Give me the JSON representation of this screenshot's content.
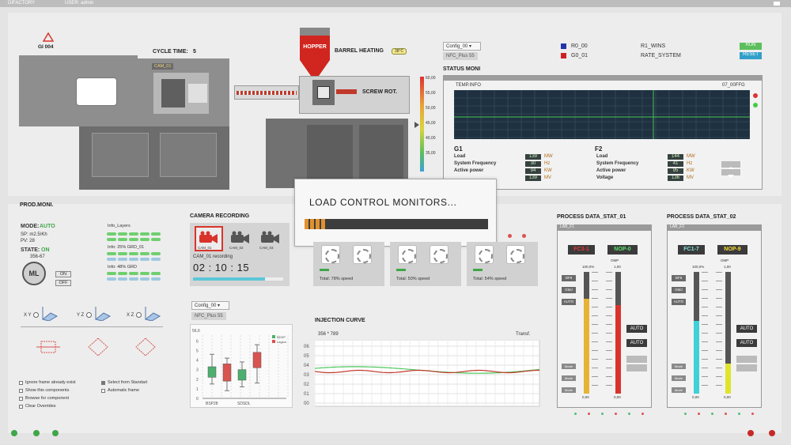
{
  "topbar": {
    "app": "DIFACTORY",
    "user": "USER: admin"
  },
  "machine": {
    "code": "GI 004",
    "cycle_label": "CYCLE TIME:",
    "cycle_value": "5",
    "cam_tag": "CAM_01",
    "hopper": "HOPPER",
    "barrel_heating": "BARREL HEATING",
    "barrel_temp": "38°C",
    "screw": "SCREW ROT."
  },
  "temp_scale": [
    "60,00",
    "55,00",
    "50,00",
    "45,00",
    "40,00",
    "35,00"
  ],
  "config": {
    "select": "Config_00",
    "nfc": "NFC_Plus 55"
  },
  "legend": {
    "r0": "R0_00",
    "g0": "G0_01",
    "r1": "R1_WINS",
    "rate": "RATE_SYSTEM",
    "run": "RUN",
    "reset": "RESET"
  },
  "status": {
    "title": "STATUS MONI",
    "temp_info": "TEMP.INFO",
    "temp_code": "07_00FFG",
    "g1": {
      "title": "G1",
      "rows": [
        {
          "label": "Load",
          "value": "139",
          "unit": "MW"
        },
        {
          "label": "System Frequency",
          "value": "30",
          "unit": "Hz"
        },
        {
          "label": "Active power",
          "value": "94",
          "unit": "KW"
        },
        {
          "label": "",
          "value": "139",
          "unit": "MV"
        }
      ]
    },
    "f2": {
      "title": "F2",
      "rows": [
        {
          "label": "Load",
          "value": "144",
          "unit": "MW"
        },
        {
          "label": "System Frequency",
          "value": "41",
          "unit": "Hz"
        },
        {
          "label": "Active power",
          "value": "95",
          "unit": "KW"
        },
        {
          "label": "Voltage",
          "value": "136",
          "unit": "MV"
        }
      ]
    }
  },
  "modal": {
    "title": "LOAD CONTROL MONITORS...",
    "progress": 0.11
  },
  "prod": {
    "title": "PROD.MONI.",
    "mode_label": "MODE:",
    "mode_value": "AUTO",
    "sp": "SP: m2.5/Kh",
    "pv": "PV: 28",
    "state_label": "STATE:",
    "state_value": "ON",
    "count": "356-67",
    "ml": "ML",
    "on": "ON",
    "off": "OFF",
    "info_layers": "Info_Layers",
    "info1": "Info: 25% GRD_01",
    "info2": "Info: 48% GRD",
    "axes": [
      "X Y",
      "Y Z",
      "X Z"
    ]
  },
  "options": [
    {
      "label": "Ignore frame already exist",
      "checked": false
    },
    {
      "label": "Select from Standart",
      "checked": true
    },
    {
      "label": "Show this components",
      "checked": false
    },
    {
      "label": "Automatic frame",
      "checked": false
    },
    {
      "label": "Browse for component",
      "checked": false
    },
    {
      "label": "Clear Overrides",
      "checked": false
    }
  ],
  "camera": {
    "title": "CAMERA RECORDING",
    "cams": [
      "CAM_01",
      "CAM_02",
      "CAM_03"
    ],
    "recording": "CAM_01 recording",
    "timer": "02 : 10 : 15"
  },
  "fans": [
    {
      "speed": "Total: 78% speed"
    },
    {
      "speed": "Total: 50% speed"
    },
    {
      "speed": "Total: 54% speed"
    }
  ],
  "config2": {
    "select": "Config_00",
    "nfc": "NFC_Plus 55"
  },
  "injection": {
    "title": "INJECTION CURVE",
    "coords": "356 * 789",
    "transf": "Transf."
  },
  "injection_y": [
    "06",
    "05",
    "04",
    "03",
    "02",
    "01",
    "00"
  ],
  "proc1": {
    "title": "PROCESS DATA_STAT_01",
    "win": "LAB_F1",
    "badge_a": "FC3-1",
    "badge_b": "NOP-0",
    "col_a": "100,0%",
    "col_b": "1,00",
    "omp": "OMP",
    "side": [
      "DF6",
      "GMJ",
      "AUTO"
    ],
    "auto1": "AUTO",
    "auto2": "AUTO",
    "mode": [
      "Mode",
      "Mode",
      "Mode"
    ],
    "bottom": [
      "0,00",
      "0,00"
    ],
    "fill_a": 0.78,
    "fill_b": 0.73
  },
  "proc2": {
    "title": "PROCESS DATA_STAT_02",
    "win": "LAB_F2",
    "badge_a": "FC1-7",
    "badge_b": "NOP-9",
    "col_a": "100,0%",
    "col_b": "1,00",
    "omp": "OMP",
    "side": [
      "DF6",
      "GMJ",
      "AUTO"
    ],
    "auto1": "AUTO",
    "auto2": "AUTO",
    "mode": [
      "Mode",
      "Mode",
      "Mode"
    ],
    "bottom": [
      "0,00",
      "0,00"
    ],
    "fill_a": 0.6,
    "fill_b": 0.25
  },
  "chart_data": {
    "type": "box",
    "categories": [
      "BSP28",
      "SDSDL"
    ],
    "title": "",
    "y_top_label": "56,6",
    "yticks": [
      "0",
      "1",
      "2",
      "3",
      "4",
      "5",
      "6"
    ],
    "legend": [
      "BDSP",
      "Lagsm"
    ],
    "ylim": [
      0,
      6.6
    ],
    "series": [
      {
        "name": "BDSP",
        "color": "#4caf6e",
        "boxes": [
          {
            "x": 0,
            "min": 1.5,
            "q1": 2.2,
            "q3": 3.3,
            "max": 4.6
          },
          {
            "x": 1,
            "min": 1.2,
            "q1": 1.9,
            "q3": 3.0,
            "max": 3.8
          }
        ]
      },
      {
        "name": "Lagsm",
        "color": "#d9534f",
        "boxes": [
          {
            "x": 0.5,
            "min": 0.8,
            "q1": 1.8,
            "q3": 3.6,
            "max": 4.2
          },
          {
            "x": 1.5,
            "min": 1.6,
            "q1": 3.2,
            "q3": 4.8,
            "max": 5.6
          }
        ]
      }
    ]
  }
}
